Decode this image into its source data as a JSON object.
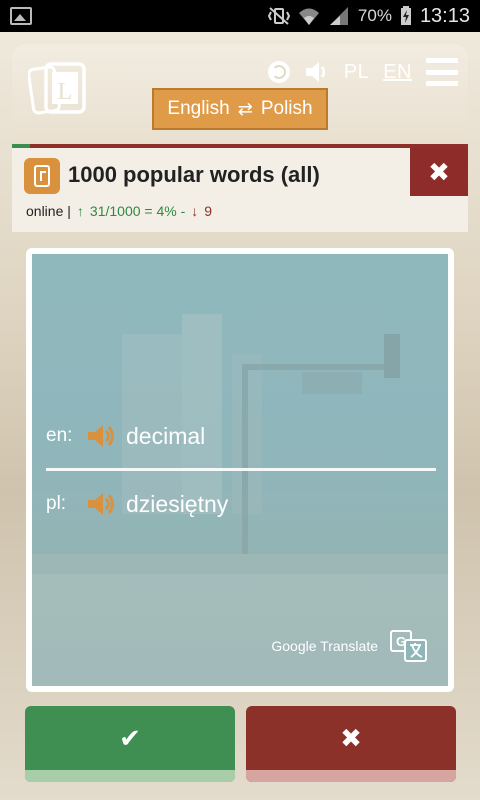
{
  "status_bar": {
    "battery": "70%",
    "time": "13:13"
  },
  "header": {
    "lang_pl": "PL",
    "lang_en": "EN",
    "direction": {
      "from": "English",
      "swap": "⇄",
      "to": "Polish"
    }
  },
  "course": {
    "title": "1000 popular words (all)",
    "close": "✖",
    "mode": "online |",
    "up_arrow": "↑",
    "progress_text": "31/1000 = 4% -",
    "down_arrow": "↓",
    "wrong_count": "9",
    "progress_fraction": 0.04
  },
  "card": {
    "rows": [
      {
        "code": "en:",
        "word": "decimal"
      },
      {
        "code": "pl:",
        "word": "dziesiętny"
      }
    ],
    "attribution": "Google Translate"
  },
  "answers": {
    "correct_glyph": "✔",
    "wrong_glyph": "✖"
  },
  "colors": {
    "accent_orange": "#e09b48",
    "correct_green": "#3f8f52",
    "wrong_red": "#8c302a",
    "card_teal": "#8fb8bd"
  },
  "icons": {
    "header": [
      "globe-icon",
      "speaker-icon",
      "hamburger-menu-icon"
    ],
    "card": [
      "speaker-icon",
      "google-translate-icon"
    ]
  }
}
